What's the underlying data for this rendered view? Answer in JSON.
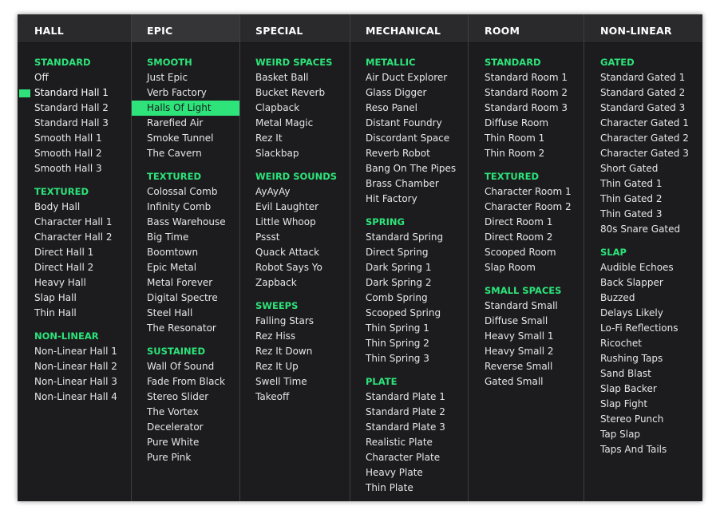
{
  "colors": {
    "panel_bg": "#1c1c1e",
    "header_bg": "#2a2a2c",
    "accent": "#2de37a",
    "text": "#e6e6e6"
  },
  "columns": [
    {
      "title": "HALL",
      "sections": [
        {
          "title": "STANDARD",
          "items": [
            "Off",
            "Standard Hall 1",
            "Standard Hall 2",
            "Standard Hall 3",
            "Smooth Hall 1",
            "Smooth Hall 2",
            "Smooth Hall 3"
          ]
        },
        {
          "title": "TEXTURED",
          "items": [
            "Body Hall",
            "Character Hall 1",
            "Character Hall 2",
            "Direct Hall 1",
            "Direct Hall 2",
            "Heavy Hall",
            "Slap Hall",
            "Thin Hall"
          ]
        },
        {
          "title": "NON-LINEAR",
          "items": [
            "Non-Linear Hall 1",
            "Non-Linear Hall 2",
            "Non-Linear Hall 3",
            "Non-Linear Hall 4"
          ]
        }
      ]
    },
    {
      "title": "EPIC",
      "sections": [
        {
          "title": "SMOOTH",
          "items": [
            "Just Epic",
            "Verb Factory",
            "Halls Of Light",
            "Rarefied Air",
            "Smoke Tunnel",
            "The Cavern"
          ]
        },
        {
          "title": "TEXTURED",
          "items": [
            "Colossal Comb",
            "Infinity Comb",
            "Bass Warehouse",
            "Big Time",
            "Boomtown",
            "Epic Metal",
            "Metal Forever",
            "Digital Spectre",
            "Steel Hall",
            "The Resonator"
          ]
        },
        {
          "title": "SUSTAINED",
          "items": [
            "Wall Of Sound",
            "Fade From Black",
            "Stereo Slider",
            "The Vortex",
            "Decelerator",
            "Pure White",
            "Pure Pink"
          ]
        }
      ]
    },
    {
      "title": "SPECIAL",
      "sections": [
        {
          "title": "WEIRD SPACES",
          "items": [
            "Basket Ball",
            "Bucket Reverb",
            "Clapback",
            "Metal Magic",
            "Rez It",
            "Slackbap"
          ]
        },
        {
          "title": "WEIRD SOUNDS",
          "items": [
            "AyAyAy",
            "Evil Laughter",
            "Little Whoop",
            "Pssst",
            "Quack Attack",
            "Robot Says Yo",
            "Zapback"
          ]
        },
        {
          "title": "SWEEPS",
          "items": [
            "Falling Stars",
            "Rez Hiss",
            "Rez It Down",
            "Rez It Up",
            "Swell Time",
            "Takeoff"
          ]
        }
      ]
    },
    {
      "title": "MECHANICAL",
      "sections": [
        {
          "title": "METALLIC",
          "items": [
            "Air Duct Explorer",
            "Glass Digger",
            "Reso Panel",
            "Distant Foundry",
            "Discordant Space",
            "Reverb Robot",
            "Bang On The Pipes",
            "Brass Chamber",
            "Hit Factory"
          ]
        },
        {
          "title": "SPRING",
          "items": [
            "Standard Spring",
            "Direct Spring",
            "Dark Spring 1",
            "Dark Spring 2",
            "Comb Spring",
            "Scooped Spring",
            "Thin Spring 1",
            "Thin Spring 2",
            "Thin Spring 3"
          ]
        },
        {
          "title": "PLATE",
          "items": [
            "Standard Plate 1",
            "Standard Plate 2",
            "Standard Plate 3",
            "Realistic Plate",
            "Character Plate",
            "Heavy Plate",
            "Thin Plate"
          ]
        }
      ]
    },
    {
      "title": "ROOM",
      "sections": [
        {
          "title": "STANDARD",
          "items": [
            "Standard Room 1",
            "Standard Room 2",
            "Standard Room 3",
            "Diffuse Room",
            "Thin Room 1",
            "Thin Room 2"
          ]
        },
        {
          "title": "TEXTURED",
          "items": [
            "Character Room 1",
            "Character Room 2",
            "Direct Room 1",
            "Direct Room 2",
            "Scooped Room",
            "Slap Room"
          ]
        },
        {
          "title": "SMALL SPACES",
          "items": [
            "Standard Small",
            "Diffuse Small",
            "Heavy Small 1",
            "Heavy Small 2",
            "Reverse Small",
            "Gated Small"
          ]
        }
      ]
    },
    {
      "title": "NON-LINEAR",
      "sections": [
        {
          "title": "GATED",
          "items": [
            "Standard Gated 1",
            "Standard Gated 2",
            "Standard Gated 3",
            "Character Gated 1",
            "Character Gated 2",
            "Character Gated 3",
            "Short Gated",
            "Thin Gated 1",
            "Thin Gated 2",
            "Thin Gated 3",
            "80s Snare Gated"
          ]
        },
        {
          "title": "SLAP",
          "items": [
            "Audible Echoes",
            "Back Slapper",
            "Buzzed",
            "Delays Likely",
            "Lo-Fi Reflections",
            "Ricochet",
            "Rushing Taps",
            "Sand Blast",
            "Slap Backer",
            "Slap Fight",
            "Stereo Punch",
            "Tap Slap",
            "Taps And Tails"
          ]
        }
      ]
    }
  ],
  "state": {
    "current_preset": "Standard Hall 1",
    "hovered_preset": "Halls Of Light"
  }
}
